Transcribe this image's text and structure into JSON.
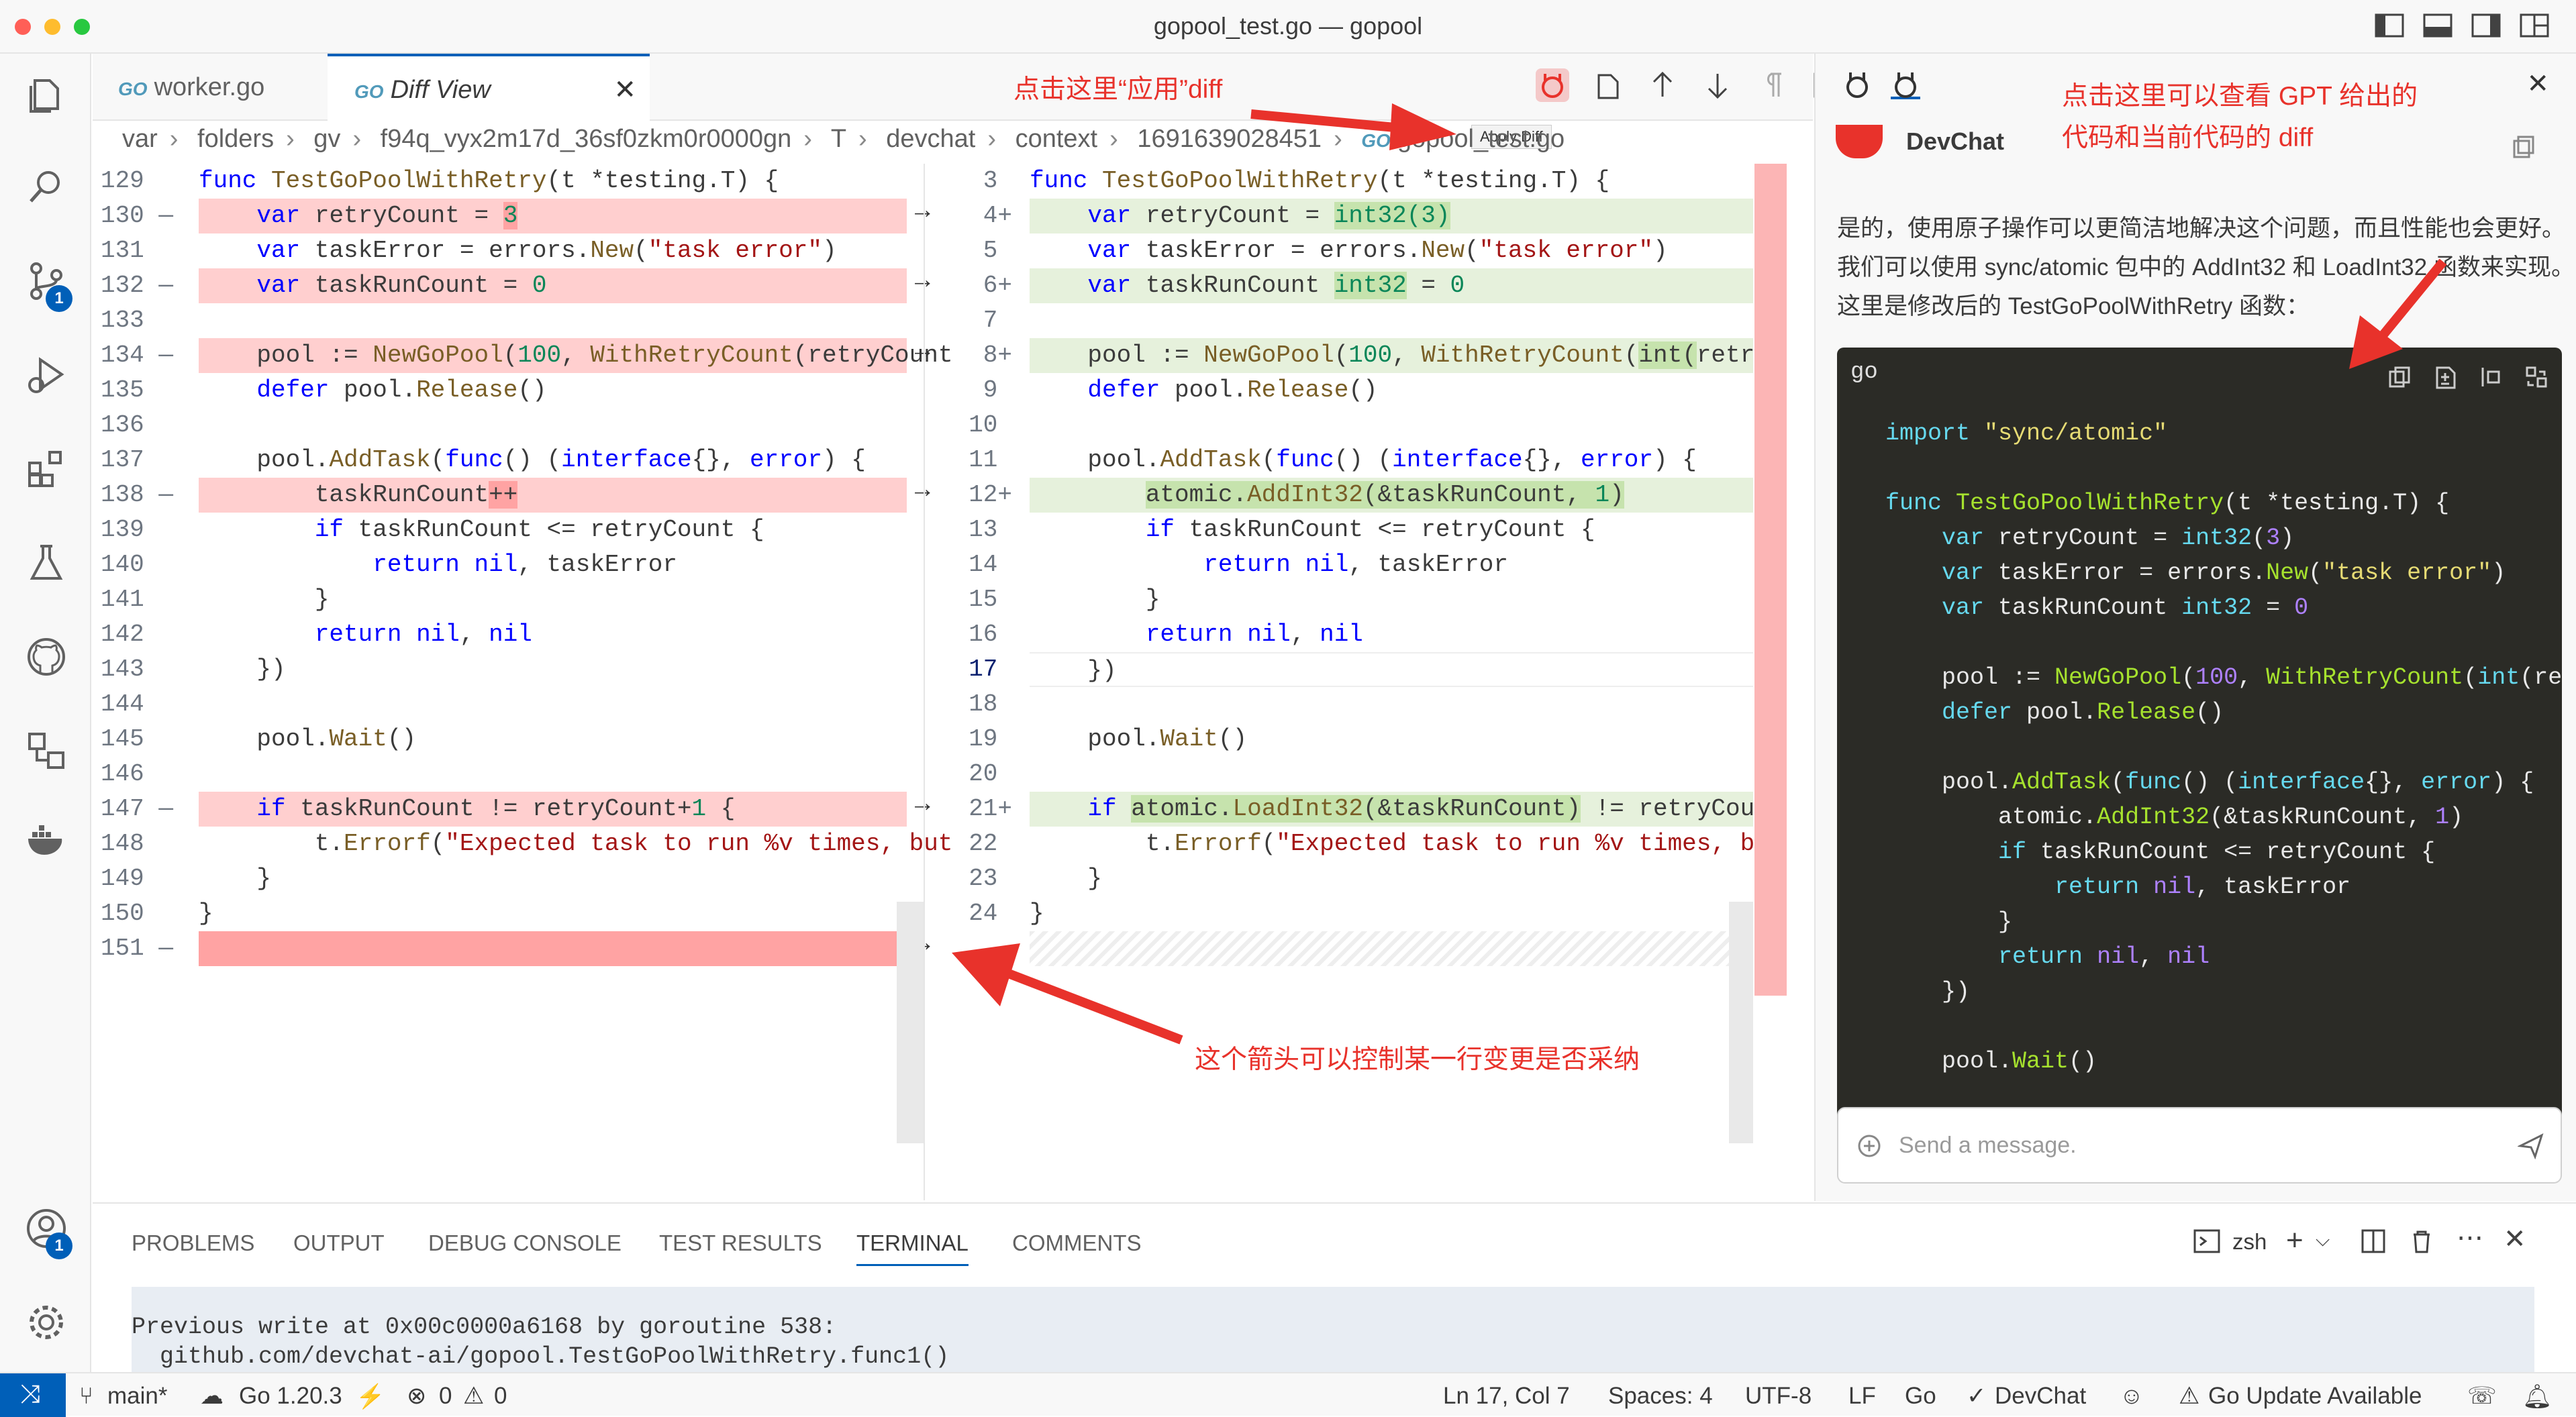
{
  "window": {
    "title": "gopool_test.go — gopool"
  },
  "tabs": [
    {
      "label": "worker.go",
      "icon": "go-file-icon"
    },
    {
      "label": "Diff View",
      "icon": "go-file-icon"
    }
  ],
  "toolbar": {
    "tooltip": "Apply Diff"
  },
  "breadcrumb": [
    "var",
    "folders",
    "gv",
    "f94q_vyx2m17d_36sf0zkm0r0000gn",
    "T",
    "devchat",
    "context",
    "1691639028451",
    "gopool_test.go"
  ],
  "badges": {
    "source_control": "1",
    "accounts": "1"
  },
  "diff": {
    "left_lines": [
      "129",
      "130",
      "131",
      "132",
      "133",
      "134",
      "135",
      "136",
      "137",
      "138",
      "139",
      "140",
      "141",
      "142",
      "143",
      "144",
      "145",
      "146",
      "147",
      "148",
      "149",
      "150",
      "151"
    ],
    "right_lines": [
      "3",
      "4",
      "5",
      "6",
      "7",
      "8",
      "9",
      "10",
      "11",
      "12",
      "13",
      "14",
      "15",
      "16",
      "17",
      "18",
      "19",
      "20",
      "21",
      "22",
      "23",
      "24"
    ]
  },
  "panel": {
    "title": "DevChat",
    "paragraph": "是的，使用原子操作可以更简洁地解决这个问题，而且性能也会更好。我们可以使用 sync/atomic 包中的 AddInt32 和 LoadInt32 函数来实现。这里是修改后的 TestGoPoolWithRetry 函数：",
    "code_lang": "go",
    "message_placeholder": "Send a message."
  },
  "bottom_tabs": [
    "PROBLEMS",
    "OUTPUT",
    "DEBUG CONSOLE",
    "TEST RESULTS",
    "TERMINAL",
    "COMMENTS"
  ],
  "terminal": {
    "shell": "zsh",
    "line1": "Previous write at 0x00c0000a6168 by goroutine 538:",
    "line2": "  github.com/devchat-ai/gopool.TestGoPoolWithRetry.func1()"
  },
  "status": {
    "branch": "main*",
    "go_version": "Go 1.20.3",
    "errors": "0",
    "warnings": "0",
    "cursor": "Ln 17, Col 7",
    "spaces": "Spaces: 4",
    "encoding": "UTF-8",
    "eol": "LF",
    "language": "Go",
    "devchat": "DevChat",
    "update": "Go Update Available"
  },
  "annotations": {
    "apply": "点击这里“应用”diff",
    "view_diff_1": "点击这里可以查看 GPT 给出的",
    "view_diff_2": "代码和当前代码的 diff",
    "arrow_line": "这个箭头可以控制某一行变更是否采纳"
  },
  "colors": {
    "accent": "#005fb8",
    "deleted": "#ffcfcf",
    "added": "#e6f1dc",
    "annotation": "#e8322b"
  }
}
